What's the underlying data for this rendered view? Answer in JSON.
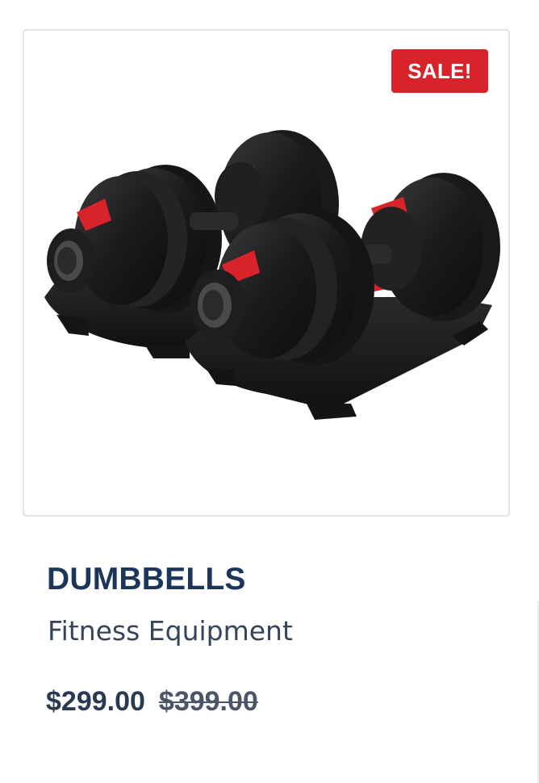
{
  "product": {
    "badge": "SALE!",
    "title": "DUMBBELLS",
    "category": "Fitness Equipment",
    "price_current": "$299.00",
    "price_original": "$399.00",
    "image_icon": "adjustable-dumbbells-image"
  },
  "colors": {
    "badge_bg": "#d8232a",
    "title": "#1c3659",
    "card_border": "#dde3e6"
  }
}
